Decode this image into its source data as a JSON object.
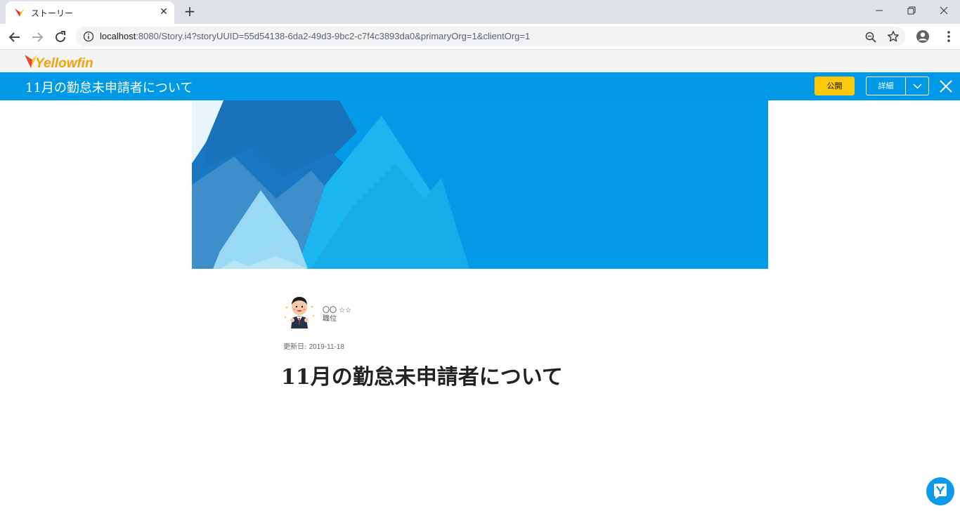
{
  "browser": {
    "tab_title": "ストーリー",
    "url_host": "localhost",
    "url_rest": ":8080/Story.i4?storyUUID=55d54138-6da2-49d3-9bc2-c7f4c3893da0&primaryOrg=1&clientOrg=1"
  },
  "app": {
    "logo_text": "Yellowfin",
    "story_title": "11月の勤怠未申請者について",
    "publish_label": "公開",
    "detail_label": "詳細"
  },
  "article": {
    "author_name": "〇〇 ☆☆",
    "author_role": "職位",
    "updated_label": "更新日: ",
    "updated_value": "2019-11-18",
    "title": "11月の勤怠未申請者について"
  },
  "colors": {
    "story_bar": "#0099e8",
    "publish_button": "#fcc80b",
    "hero_base": "#039be8"
  }
}
